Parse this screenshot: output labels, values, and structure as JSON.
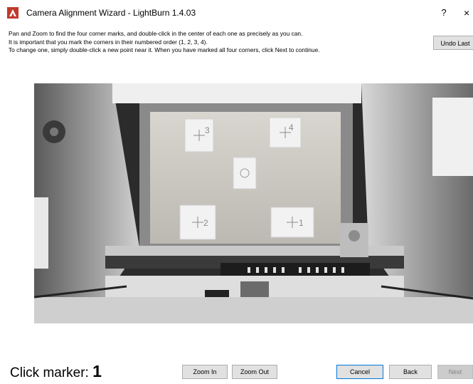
{
  "window": {
    "title": "Camera Alignment Wizard - LightBurn 1.4.03",
    "help_glyph": "?",
    "close_glyph": "×",
    "icon": "lightburn-flame-icon"
  },
  "instructions": {
    "line1": "Pan and Zoom to find the four corner marks, and double-click in the center of each one as precisely as you can.",
    "line2": "It is important that you mark the corners in their numbered order (1, 2, 3, 4).",
    "line3": "To change one, simply double-click a new point near it.  When you have marked all four corners, click Next to continue."
  },
  "buttons": {
    "undo_last": "Undo Last",
    "zoom_in": "Zoom In",
    "zoom_out": "Zoom Out",
    "cancel": "Cancel",
    "back": "Back",
    "next": "Next"
  },
  "status": {
    "label": "Click marker:",
    "marker_number": "1"
  },
  "camera": {
    "marks": [
      "3",
      "4",
      "2",
      "1"
    ]
  }
}
